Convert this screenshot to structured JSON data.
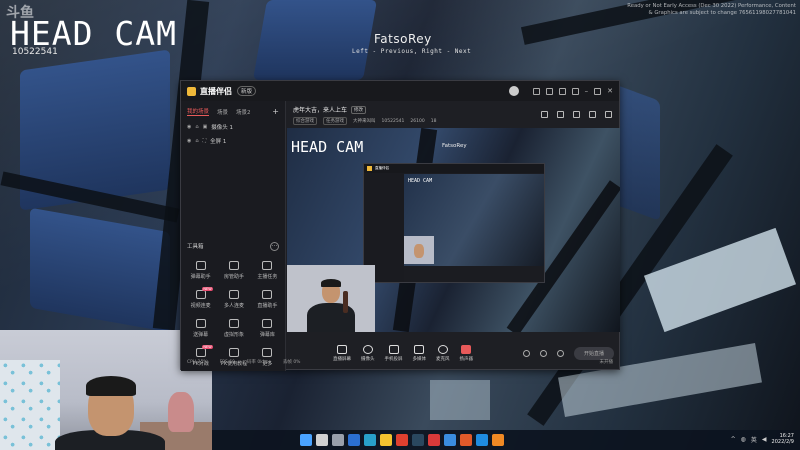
{
  "overlay": {
    "watermark": "斗鱼",
    "title": "HEAD CAM",
    "room_id": "10522541",
    "streamer_name": "FatsoRey",
    "streamer_hint": "Left - Previous, Right - Next",
    "game_notice": "Ready or Not Early Access (Dec 30 2022) Performance, Content & Graphics are subject to change 76561198027781041"
  },
  "app": {
    "name": "直播伴侣",
    "version_badge": "新版",
    "titlebar_text": "设置",
    "sidebar": {
      "tabs": [
        "我的场景",
        "场景",
        "场景2"
      ],
      "add_label": "+",
      "scenes": [
        {
          "label": "摄像头 1"
        },
        {
          "label": "全屏 1"
        }
      ],
      "toolbox_title": "工具箱",
      "toolbox_more": "···",
      "tools": [
        {
          "label": "弹幕助手",
          "new": ""
        },
        {
          "label": "房管助手",
          "new": ""
        },
        {
          "label": "主播任务",
          "new": ""
        },
        {
          "label": "视频连麦",
          "new": "NEW"
        },
        {
          "label": "多人连麦",
          "new": ""
        },
        {
          "label": "直播助手",
          "new": ""
        },
        {
          "label": "送弹幕",
          "new": ""
        },
        {
          "label": "虚拟形象",
          "new": ""
        },
        {
          "label": "弹幕库",
          "new": ""
        },
        {
          "label": "PK对战",
          "new": "NEW"
        },
        {
          "label": "PK使用教程",
          "new": ""
        },
        {
          "label": "更多",
          "new": ""
        }
      ]
    },
    "stream": {
      "title": "虎年大吉，来人上车",
      "edit_label": "修改",
      "category_tag": "综合游戏",
      "tag2": "任务游戏",
      "sub_category": "大神来叫叫",
      "room_id": "10522541",
      "viewers": "26100",
      "fans": "18"
    },
    "preview": {
      "overlay_title": "HEAD CAM",
      "overlay_name": "FatsoRey",
      "nested_title": "HEAD CAM"
    },
    "controls": [
      {
        "label": "直播屏幕"
      },
      {
        "label": "摄像头"
      },
      {
        "label": "手机投屏"
      },
      {
        "label": "多媒体"
      },
      {
        "label": "麦克风"
      },
      {
        "label": "扬声器"
      }
    ],
    "start_button": "开始直播",
    "statusbar": {
      "cpu": "CPU 25%",
      "fps": "FPS 60",
      "bitrate": "码率 0kbps",
      "dropped": "丢帧 0%",
      "right": "未开播"
    }
  },
  "taskbar": {
    "icons": [
      {
        "name": "windows",
        "color": "#4aa3ff"
      },
      {
        "name": "search",
        "color": "#d0d0d0"
      },
      {
        "name": "taskview",
        "color": "#9aa0aa"
      },
      {
        "name": "widgets",
        "color": "#2b6fd1"
      },
      {
        "name": "edge",
        "color": "#28a0c8"
      },
      {
        "name": "explorer",
        "color": "#f4c430"
      },
      {
        "name": "app1",
        "color": "#e0402f"
      },
      {
        "name": "steam",
        "color": "#2a475e"
      },
      {
        "name": "game",
        "color": "#d93a3a"
      },
      {
        "name": "app2",
        "color": "#3a8de0"
      },
      {
        "name": "app3",
        "color": "#e05a2a"
      },
      {
        "name": "app4",
        "color": "#1f8ce0"
      },
      {
        "name": "app5",
        "color": "#f08a24"
      }
    ],
    "clock_time": "16:27",
    "clock_date": "2022/2/9"
  }
}
